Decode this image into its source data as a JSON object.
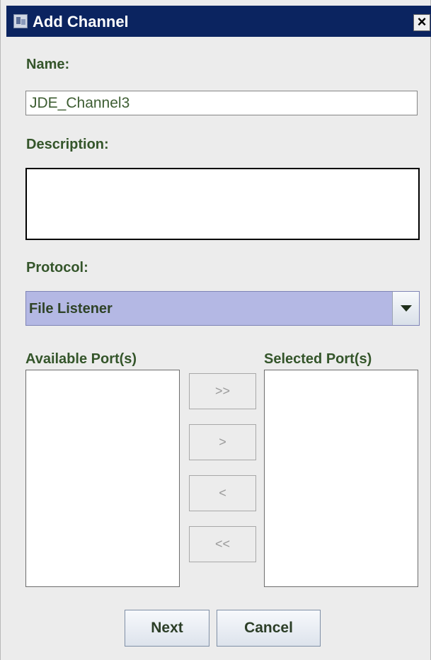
{
  "window": {
    "title": "Add Channel",
    "close_label": "×",
    "icon": "app-window-icon"
  },
  "form": {
    "name_label": "Name:",
    "name_value": "JDE_Channel3",
    "description_label": "Description:",
    "description_value": "",
    "protocol_label": "Protocol:",
    "protocol_value": "File Listener",
    "available_ports_label": "Available Port(s)",
    "selected_ports_label": "Selected Port(s)"
  },
  "transfer_buttons": {
    "add_all": ">>",
    "add": ">",
    "remove": "<",
    "remove_all": "<<"
  },
  "actions": {
    "next": "Next",
    "cancel": "Cancel"
  },
  "colors": {
    "title_bar": "#0b2460",
    "combo_selected": "#b4b8e4",
    "label_text": "#34552a"
  }
}
